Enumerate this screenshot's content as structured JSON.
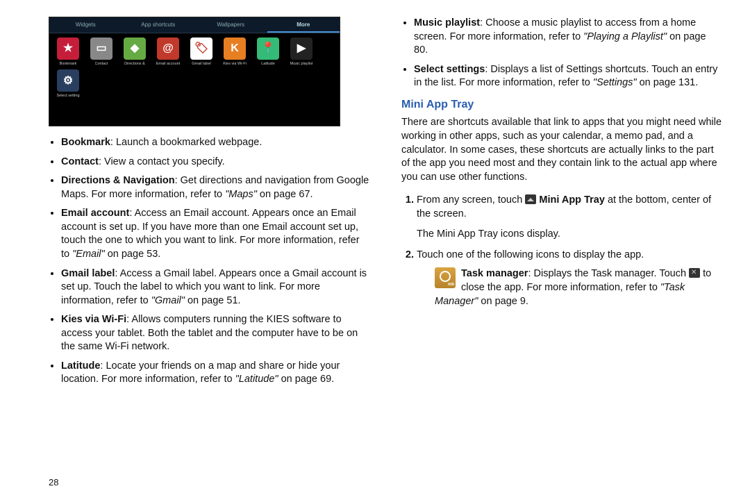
{
  "screenshot": {
    "tabs": [
      {
        "label": "Widgets",
        "active": false
      },
      {
        "label": "App shortcuts",
        "active": false
      },
      {
        "label": "Wallpapers",
        "active": false
      },
      {
        "label": "More",
        "active": true
      }
    ],
    "row1": [
      {
        "label": "Bookmark",
        "bg": "#c41e3a",
        "glyph": "★"
      },
      {
        "label": "Contact",
        "bg": "#888",
        "glyph": "▭"
      },
      {
        "label": "Directions &",
        "bg": "#6a4",
        "glyph": "◆"
      },
      {
        "label": "Email account",
        "bg": "#c0392b",
        "glyph": "@"
      },
      {
        "label": "Gmail label",
        "bg": "#fff",
        "glyph": "🏷"
      },
      {
        "label": "Kies via Wi-Fi",
        "bg": "#e67e22",
        "glyph": "K"
      },
      {
        "label": "Latitude",
        "bg": "#3b7",
        "glyph": "📍"
      },
      {
        "label": "Music playlist",
        "bg": "#222",
        "glyph": "▶"
      }
    ],
    "row2": [
      {
        "label": "Select setting",
        "bg": "#2a3f5f",
        "glyph": "⚙"
      }
    ]
  },
  "leftBullets": [
    {
      "term": "Bookmark",
      "rest": ": Launch a bookmarked webpage."
    },
    {
      "term": "Contact",
      "rest": ": View a contact you specify."
    },
    {
      "term": "Directions & Navigation",
      "rest": ": Get directions and navigation from Google Maps. For more information, refer to ",
      "ref": "\"Maps\"",
      "tail": " on page 67."
    },
    {
      "term": "Email account",
      "rest": ": Access an Email account. Appears once an Email account is set up. If you have more than one Email account set up, touch the one to which you want to link. For more information, refer to ",
      "ref": "\"Email\"",
      "tail": " on page 53."
    },
    {
      "term": "Gmail label",
      "rest": ": Access a Gmail label. Appears once a Gmail account is set up. Touch the label to which you want to link. For more information, refer to ",
      "ref": "\"Gmail\"",
      "tail": " on page 51."
    },
    {
      "term": "Kies via Wi-Fi",
      "rest": ": Allows computers running the KIES software to access your tablet. Both the tablet and the computer have to be on the same Wi-Fi network."
    },
    {
      "term": "Latitude",
      "rest": ": Locate your friends on a map and share or hide your location. For more information, refer to ",
      "ref": "\"Latitude\"",
      "tail": " on page 69."
    }
  ],
  "rightBullets": [
    {
      "term": "Music playlist",
      "rest": ": Choose a music playlist to access from a home screen. For more information, refer to ",
      "ref": "\"Playing a Playlist\"",
      "tail": " on page 80."
    },
    {
      "term": "Select settings",
      "rest": ": Displays a list of Settings shortcuts. Touch an entry in the list. For more information, refer to ",
      "ref": "\"Settings\"",
      "tail": " on page 131."
    }
  ],
  "heading": "Mini App Tray",
  "intro": "There are shortcuts available that link to apps that you might need while working in other apps, such as your calendar, a memo pad, and a calculator. In some cases, these shortcuts are actually links to the part of the app you need most and they contain link to the actual app where you can use other functions.",
  "step1_a": "From any screen, touch ",
  "step1_bold": "Mini App Tray",
  "step1_b": " at the bottom, center of the screen.",
  "step1_c": "The Mini App Tray icons display.",
  "step2": "Touch one of the following icons to display the app.",
  "taskTerm": "Task manager",
  "task_a": ": Displays the Task manager. Touch ",
  "task_b": " to close the app. For more information, refer to ",
  "task_ref": "\"Task Manager\"",
  "task_tail": " on page 9.",
  "pageNumber": "28"
}
